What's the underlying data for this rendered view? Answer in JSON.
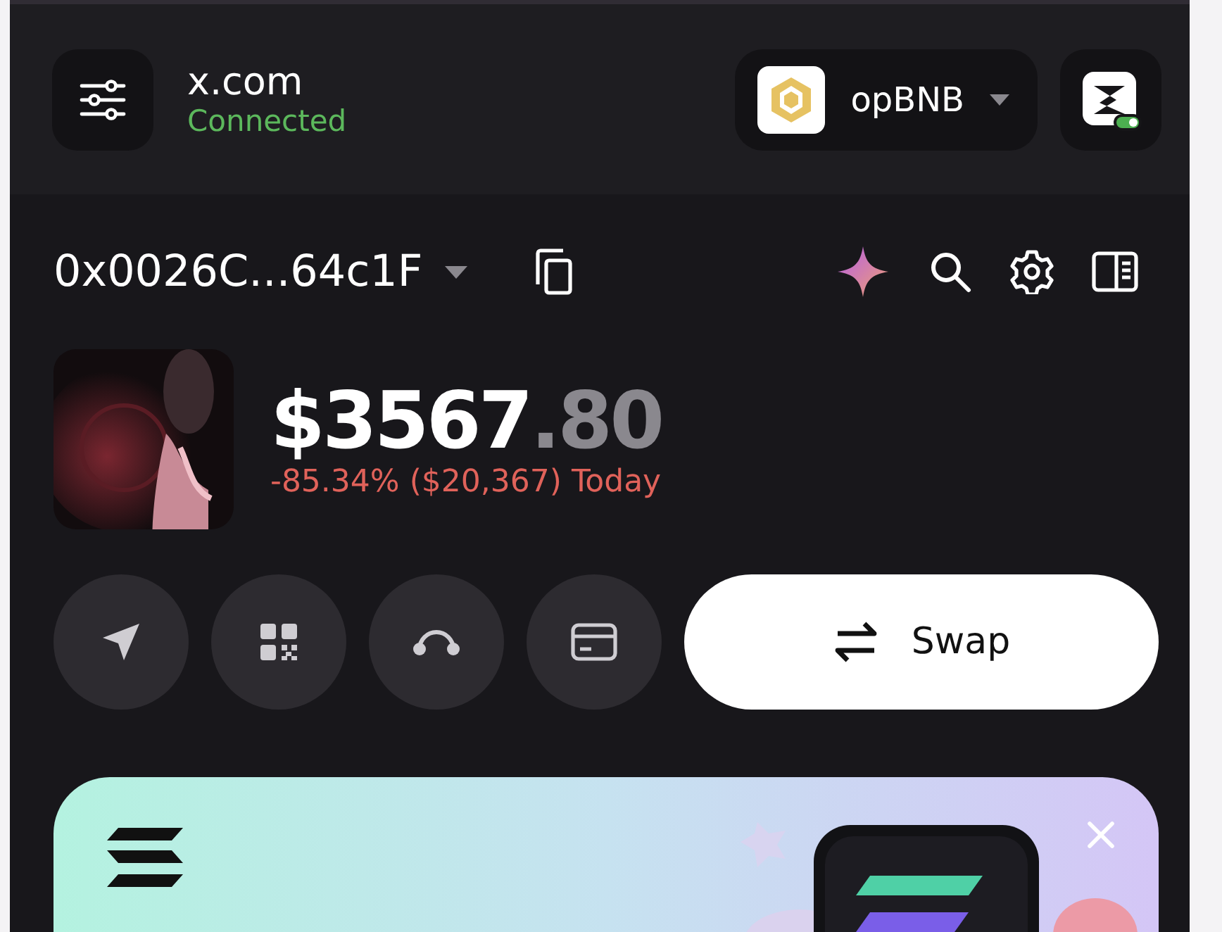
{
  "site": {
    "domain": "x.com",
    "status": "Connected"
  },
  "network": {
    "name": "opBNB"
  },
  "account": {
    "address": "0x0026C...64c1F"
  },
  "balance": {
    "whole": "$3567",
    "cents": ".80",
    "change": "-85.34% ($20,367) Today"
  },
  "swap": {
    "label": "Swap"
  }
}
